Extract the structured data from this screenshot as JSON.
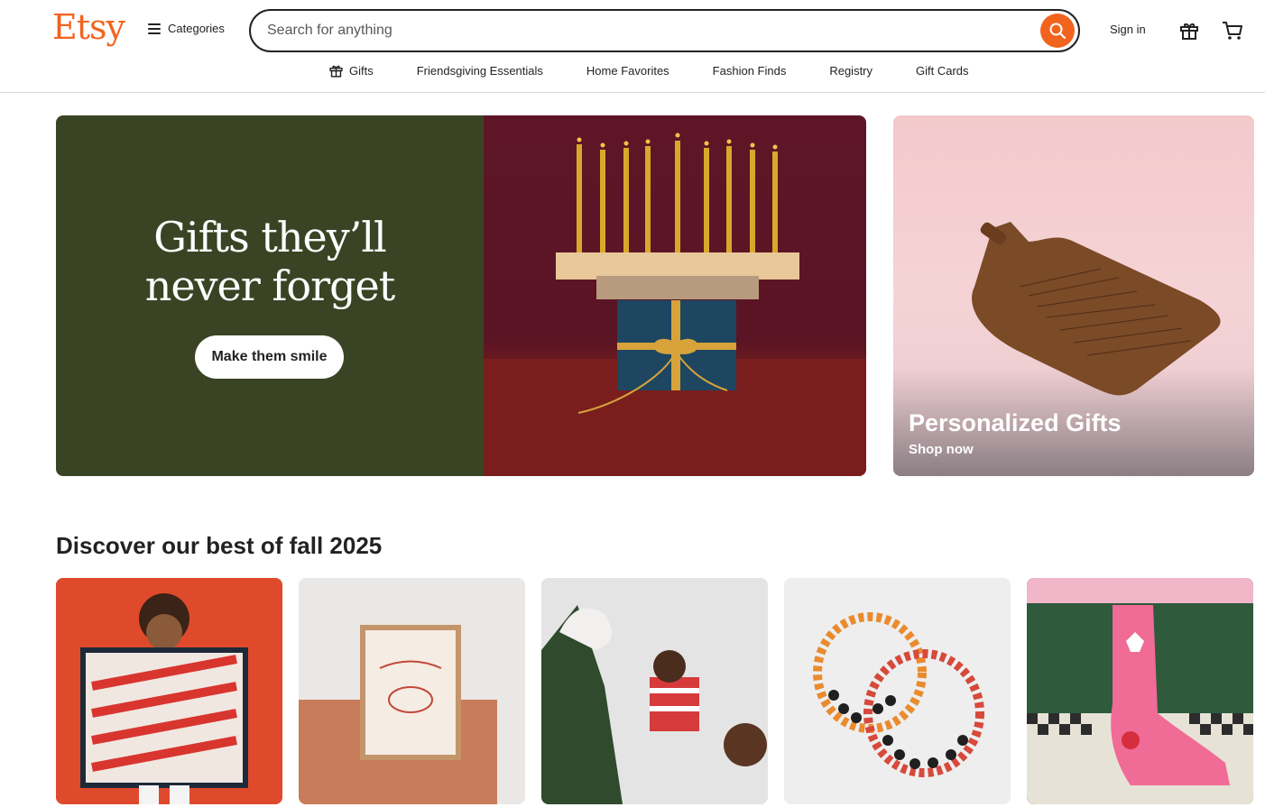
{
  "header": {
    "logo": "Etsy",
    "categories_label": "Categories",
    "search_placeholder": "Search for anything",
    "signin_label": "Sign in"
  },
  "nav": {
    "items": [
      {
        "label": "Gifts",
        "icon": "gift-icon"
      },
      {
        "label": "Friendsgiving Essentials"
      },
      {
        "label": "Home Favorites"
      },
      {
        "label": "Fashion Finds"
      },
      {
        "label": "Registry"
      },
      {
        "label": "Gift Cards"
      }
    ]
  },
  "hero": {
    "title_line1": "Gifts they’ll",
    "title_line2": "never forget",
    "button_label": "Make them smile"
  },
  "promo": {
    "title": "Personalized Gifts",
    "subtitle": "Shop now"
  },
  "section": {
    "title": "Discover our best of fall 2025"
  },
  "colors": {
    "brand": "#f1641e",
    "hero_green": "#3a4424",
    "hero_maroon": "#5e1627"
  }
}
